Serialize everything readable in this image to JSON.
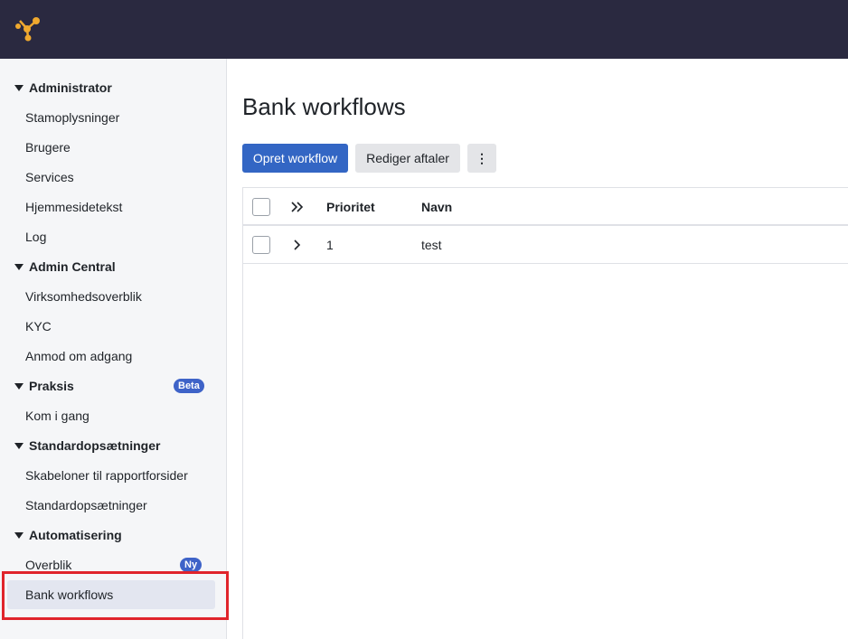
{
  "colors": {
    "topbar": "#2a2940",
    "logo": "#f0a92e",
    "primary": "#3366c4",
    "badge": "#3e63c8",
    "highlight": "#e0242b"
  },
  "sidebar": {
    "groups": [
      {
        "label": "Administrator",
        "items": [
          "Stamoplysninger",
          "Brugere",
          "Services",
          "Hjemmesidetekst",
          "Log"
        ]
      },
      {
        "label": "Admin Central",
        "items": [
          "Virksomhedsoverblik",
          "KYC",
          "Anmod om adgang"
        ]
      },
      {
        "label": "Praksis",
        "badge": "Beta",
        "items": [
          "Kom i gang"
        ]
      },
      {
        "label": "Standardopsætninger",
        "items": [
          "Skabeloner til rapportforsider",
          "Standardopsætninger"
        ]
      },
      {
        "label": "Automatisering",
        "items": [
          "Overblik",
          "Bank workflows"
        ]
      }
    ],
    "overblik_badge": "Ny",
    "active_item": "Bank workflows"
  },
  "main": {
    "title": "Bank workflows",
    "create_button": "Opret workflow",
    "edit_button": "Rediger aftaler",
    "more_button": "⋮",
    "table": {
      "columns": [
        "Prioritet",
        "Navn"
      ],
      "rows": [
        {
          "priority": "1",
          "name": "test"
        }
      ]
    }
  }
}
